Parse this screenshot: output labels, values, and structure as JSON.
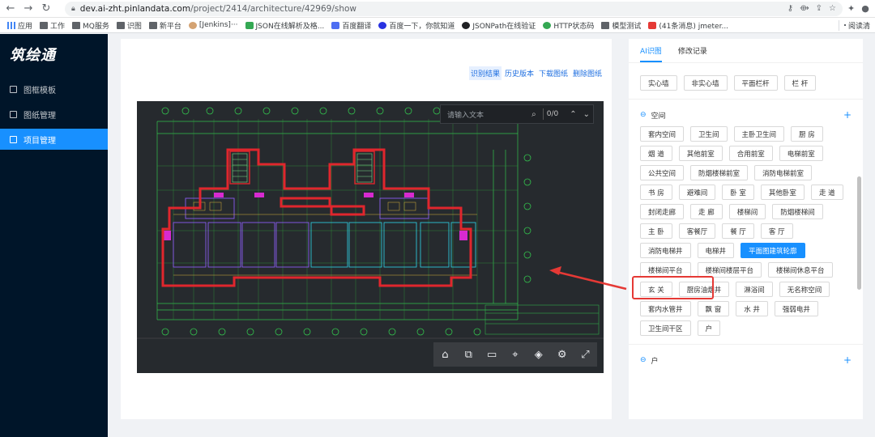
{
  "browser": {
    "url_host": "dev.ai-zht.pinlandata.com",
    "url_path": "/project/2414/architecture/42969/show",
    "bookmarks": [
      "应用",
      "工作",
      "MQ服务",
      "识图",
      "新平台",
      "[Jenkins]···",
      "JSON在线解析及格...",
      "百度翻译",
      "百度一下，你就知道",
      "JSONPath在线验证",
      "HTTP状态码",
      "模型测试",
      "(41条消息) jmeter..."
    ],
    "reading_list": "阅读清"
  },
  "sidebar": {
    "logo": "筑绘通",
    "items": [
      {
        "label": "图框模板",
        "active": false
      },
      {
        "label": "图纸管理",
        "active": false
      },
      {
        "label": "项目管理",
        "active": true
      }
    ]
  },
  "viewer": {
    "actions": [
      "识别结果",
      "历史版本",
      "下载图纸",
      "删除图纸"
    ],
    "search_placeholder": "请输入文本",
    "search_count": "0/0",
    "tool_icons": [
      "home-icon",
      "zoom-window-icon",
      "measure-icon",
      "locate-icon",
      "layers-icon",
      "settings-icon",
      "fullscreen-icon"
    ]
  },
  "panel": {
    "tabs": [
      "AI识图",
      "修改记录"
    ],
    "top_tags": [
      "实心墙",
      "非实心墙",
      "平面栏杆",
      "栏 杆"
    ],
    "space_section": {
      "title": "空间",
      "tags": [
        "套内空间",
        "卫生间",
        "主卧卫生间",
        "厨 房",
        "烟 道",
        "其他前室",
        "合用前室",
        "电梯前室",
        "公共空间",
        "防烟楼梯前室",
        "消防电梯前室",
        "书 房",
        "避难间",
        "卧 室",
        "其他卧室",
        "走 道",
        "封闭走廊",
        "走 廊",
        "楼梯间",
        "防烟楼梯间",
        "主 卧",
        "客餐厅",
        "餐 厅",
        "客 厅",
        "消防电梯井",
        "电梯井",
        "平面图建筑轮廓",
        "楼梯间平台",
        "楼梯间楼层平台",
        "楼梯间休息平台",
        "玄 关",
        "厨房油烟井",
        "淋浴间",
        "无名称空间",
        "套内水管井",
        "飘 窗",
        "水 井",
        "强弱电井",
        "卫生间干区",
        "户"
      ],
      "selected": "平面图建筑轮廓"
    },
    "next_section": {
      "title": "户"
    }
  },
  "colors": {
    "accent": "#1890ff",
    "sidebar_bg": "#001529",
    "highlight": "#e53935"
  }
}
